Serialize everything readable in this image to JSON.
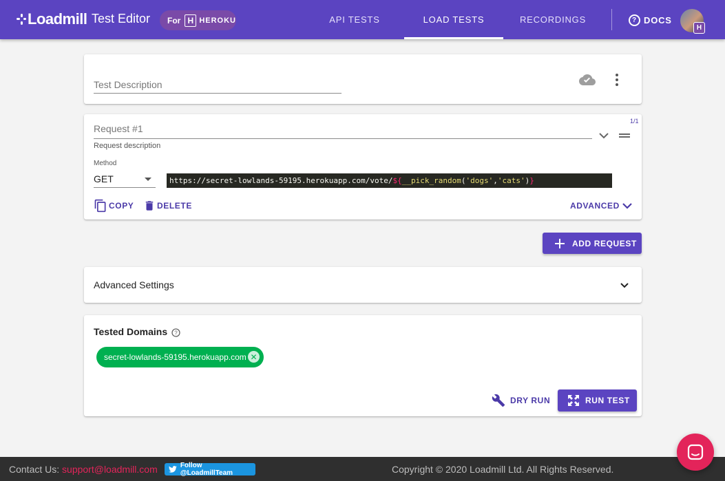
{
  "header": {
    "logo_text": "Loadmill",
    "app_title": "Test Editor",
    "heroku_badge": {
      "prefix": "For",
      "letter": "H",
      "name": "HEROKU"
    },
    "tabs": [
      {
        "label": "API TESTS"
      },
      {
        "label": "LOAD TESTS"
      },
      {
        "label": "RECORDINGS"
      }
    ],
    "active_tab": "LOAD TESTS",
    "docs_label": "DOCS",
    "avatar_badge": "H"
  },
  "description_card": {
    "placeholder": "Test Description"
  },
  "request_card": {
    "counter": "1/1",
    "name_placeholder": "Request #1",
    "description_label": "Request description",
    "method_label": "Method",
    "method_value": "GET",
    "url": {
      "prefix": "https://secret-lowlands-59195.herokuapp.com/vote/",
      "param_open": "${",
      "fn": "__pick_random",
      "paren_open": "(",
      "arg1": "'dogs'",
      "comma": ",",
      "arg2": "'cats'",
      "paren_close": ")",
      "param_close": "}"
    },
    "copy_label": "COPY",
    "delete_label": "DELETE",
    "advanced_label": "ADVANCED"
  },
  "add_request_label": "ADD REQUEST",
  "advanced_settings": {
    "title": "Advanced Settings"
  },
  "tested_domains": {
    "title": "Tested Domains",
    "domains": [
      "secret-lowlands-59195.herokuapp.com"
    ],
    "dry_run_label": "DRY RUN",
    "run_test_label": "RUN TEST"
  },
  "footer": {
    "contact_label": "Contact Us:",
    "contact_email": "support@loadmill.com",
    "twitter_label": "Follow @LoadmillTeam",
    "copyright": "Copyright © 2020 Loadmill Ltd. All Rights Reserved."
  },
  "colors": {
    "brand": "#5b44c1",
    "heroku": "#7a4aa8",
    "domain_chip": "#00b050",
    "accent_pink": "#e3245a"
  }
}
